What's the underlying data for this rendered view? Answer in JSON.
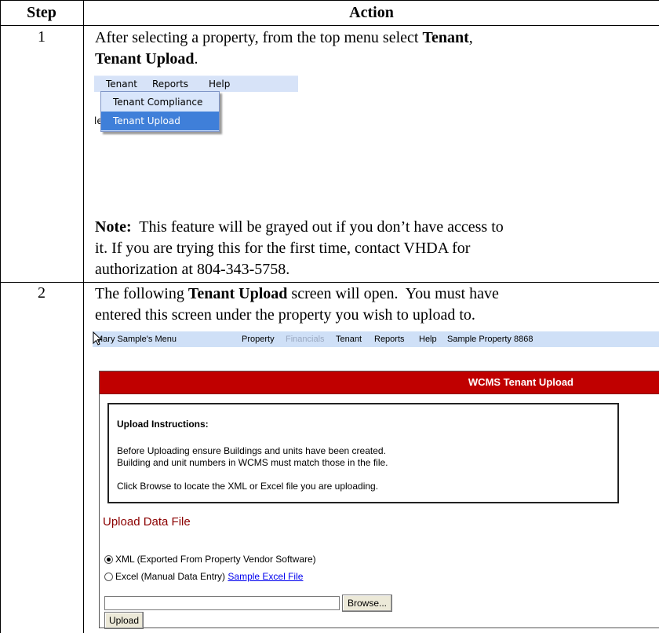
{
  "table": {
    "col_step_header": "Step",
    "col_action_header": "Action"
  },
  "row1": {
    "step": "1",
    "line1_pre": "After selecting a property, from the top menu select ",
    "line1_bold": "Tenant",
    "line1_post": ",",
    "line2_bold": "Tenant Upload",
    "line2_post": ".",
    "menu": {
      "items": [
        "Tenant",
        "Reports",
        "Help"
      ],
      "dropdown": [
        "Tenant Compliance",
        "Tenant Upload"
      ],
      "selected": "Tenant Upload",
      "fragment": "le"
    },
    "note_label": "Note:",
    "note_line1": "  This feature will be grayed out if you don’t have access to",
    "note_line2": "it.  If you are trying this for the first time, contact VHDA for",
    "note_line3": "authorization at 804-343-5758."
  },
  "row2": {
    "step": "2",
    "line1_pre": "The following ",
    "line1_bold": "Tenant Upload",
    "line1_post": " screen will open.  You must have",
    "line2": "entered this screen under the property you wish to upload to.",
    "screen": {
      "nav": {
        "menu_title": "Mary Sample's Menu",
        "items": [
          "Property",
          "Financials",
          "Tenant",
          "Reports",
          "Help"
        ],
        "property_name": "Sample Property 8868"
      },
      "header_title": "WCMS Tenant Upload",
      "instructions_title": "Upload Instructions:",
      "instructions": [
        "Before Uploading ensure Buildings and units have been created.",
        "Building and unit numbers in WCMS must match those in the file.",
        "Click Browse to locate the XML or Excel file you are uploading."
      ],
      "upload_title": "Upload Data File",
      "option_xml": "XML (Exported From Property Vendor Software)",
      "option_excel": "Excel (Manual Data Entry)",
      "sample_link": "Sample Excel File",
      "browse_label": "Browse...",
      "upload_label": "Upload",
      "file_value": ""
    }
  }
}
